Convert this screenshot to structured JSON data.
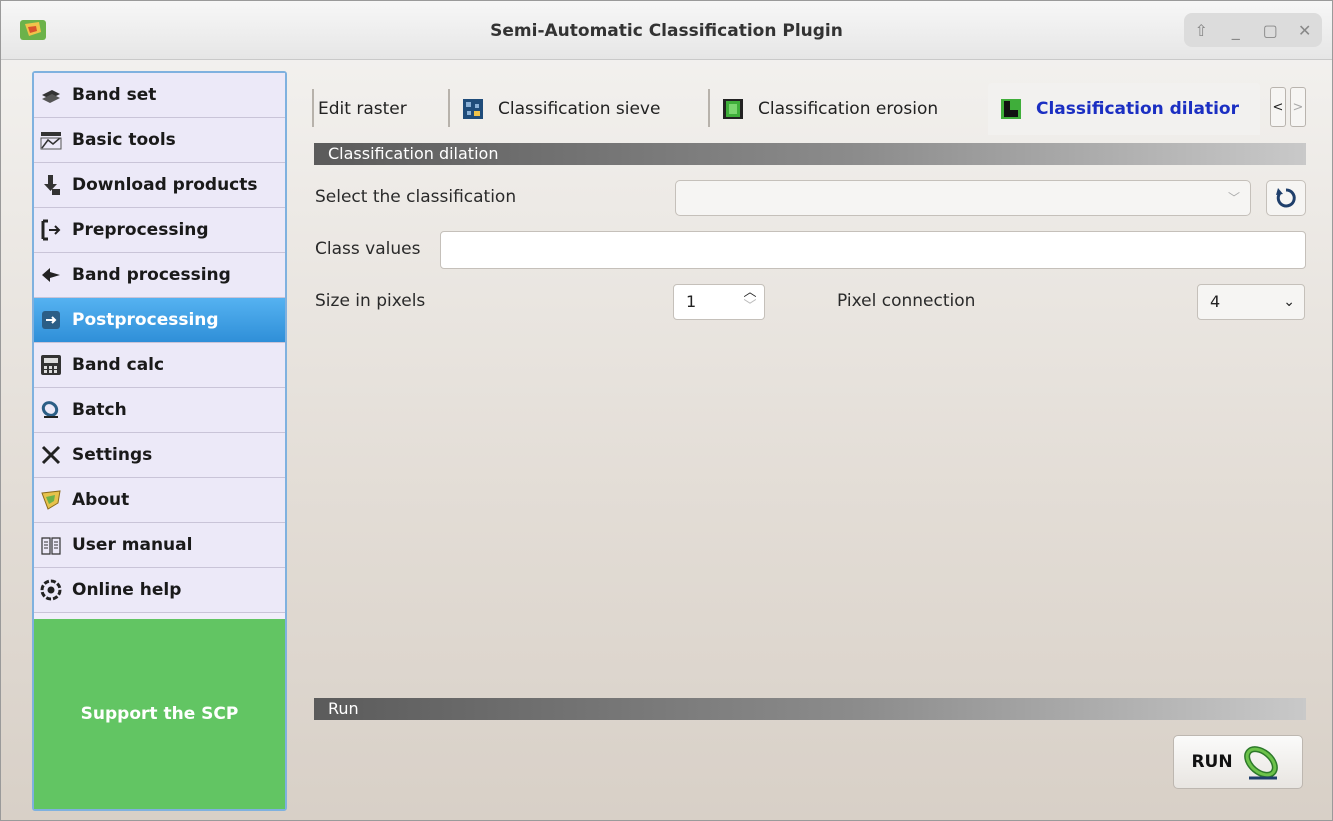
{
  "window": {
    "title": "Semi-Automatic Classification Plugin",
    "controls": [
      "⇧",
      "_",
      "▢",
      "✕"
    ]
  },
  "sidebar": {
    "items": [
      {
        "label": "Band set",
        "icon": "band-set-icon"
      },
      {
        "label": "Basic tools",
        "icon": "basic-tools-icon"
      },
      {
        "label": "Download products",
        "icon": "download-icon"
      },
      {
        "label": "Preprocessing",
        "icon": "preprocessing-icon"
      },
      {
        "label": "Band processing",
        "icon": "band-processing-icon"
      },
      {
        "label": "Postprocessing",
        "icon": "postprocessing-icon",
        "active": true
      },
      {
        "label": "Band calc",
        "icon": "band-calc-icon"
      },
      {
        "label": "Batch",
        "icon": "batch-icon"
      },
      {
        "label": "Settings",
        "icon": "settings-icon"
      },
      {
        "label": "About",
        "icon": "about-icon"
      },
      {
        "label": "User manual",
        "icon": "user-manual-icon"
      },
      {
        "label": "Online help",
        "icon": "online-help-icon"
      }
    ],
    "support_label": "Support the SCP"
  },
  "tabs": {
    "items": [
      {
        "label": "Edit raster"
      },
      {
        "label": "Classification sieve"
      },
      {
        "label": "Classification erosion"
      },
      {
        "label": "Classification dilatior"
      }
    ],
    "scroll_left": "<",
    "scroll_right": ">"
  },
  "section": {
    "title": "Classification dilation",
    "run_title": "Run"
  },
  "form": {
    "select_classification_label": "Select the classification",
    "select_classification_value": "",
    "class_values_label": "Class values",
    "class_values_value": "",
    "size_label": "Size in pixels",
    "size_value": "1",
    "pixel_connection_label": "Pixel connection",
    "pixel_connection_value": "4"
  },
  "run_button": {
    "label": "RUN"
  },
  "colors": {
    "active_sidebar": "#3a9be3",
    "support": "#62c563",
    "active_tab_text": "#1b2fc2"
  }
}
